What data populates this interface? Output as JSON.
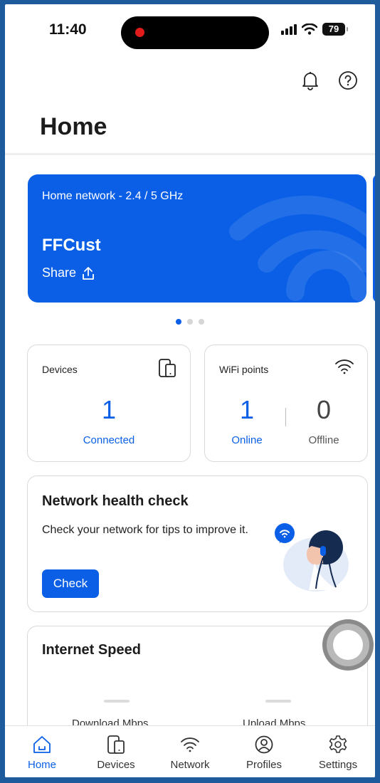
{
  "status_bar": {
    "time": "11:40",
    "battery": "79"
  },
  "header": {
    "title": "Home"
  },
  "network_card": {
    "label": "Home network - 2.4 / 5 GHz",
    "ssid": "FFCust",
    "share_label": "Share"
  },
  "carousel": {
    "pages": 3,
    "active": 0
  },
  "devices": {
    "caption": "Devices",
    "count": "1",
    "status": "Connected"
  },
  "wifi_points": {
    "caption": "WiFi points",
    "online_count": "1",
    "online_label": "Online",
    "offline_count": "0",
    "offline_label": "Offline"
  },
  "health_check": {
    "title": "Network health check",
    "description": "Check your network for tips to improve it.",
    "button": "Check"
  },
  "internet_speed": {
    "title": "Internet Speed",
    "download_label": "Download Mbps",
    "upload_label": "Upload Mbps"
  },
  "tabs": [
    {
      "label": "Home",
      "icon": "home-icon"
    },
    {
      "label": "Devices",
      "icon": "devices-icon"
    },
    {
      "label": "Network",
      "icon": "wifi-icon"
    },
    {
      "label": "Profiles",
      "icon": "profile-icon"
    },
    {
      "label": "Settings",
      "icon": "gear-icon"
    }
  ],
  "colors": {
    "accent": "#0a5fe6",
    "frame": "#1d5b9c"
  }
}
